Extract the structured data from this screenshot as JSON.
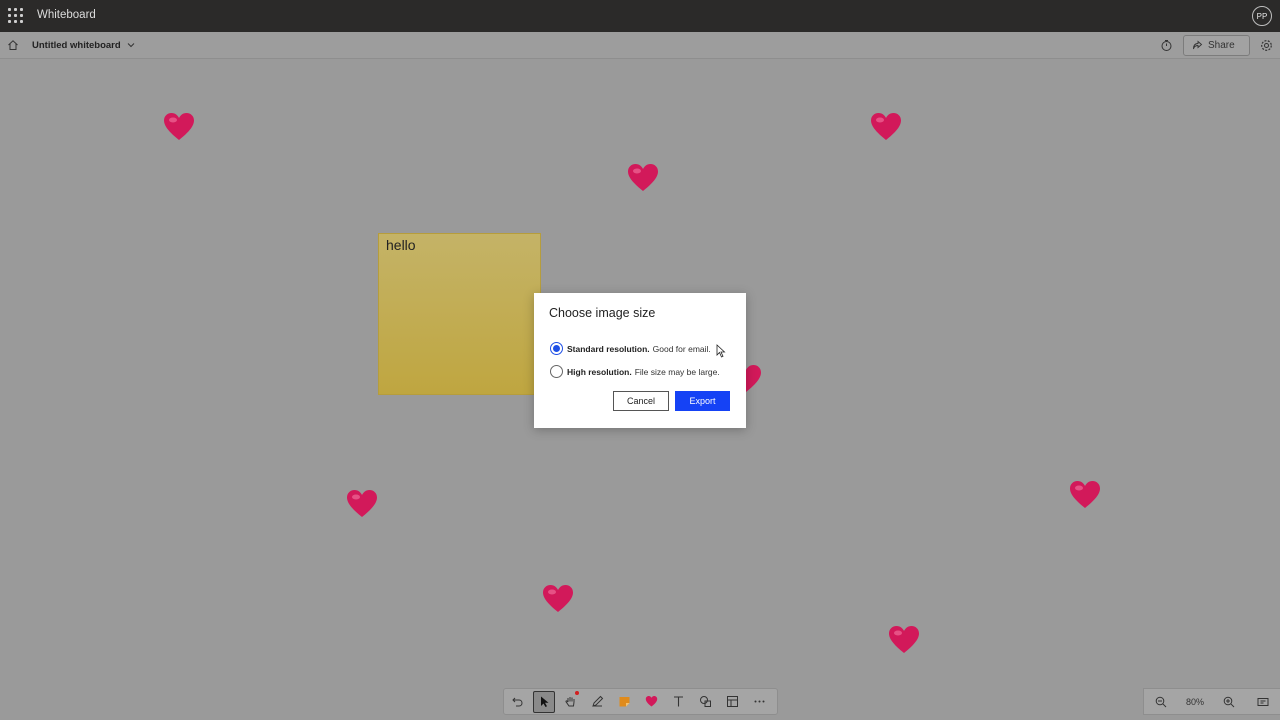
{
  "topbar": {
    "app_title": "Whiteboard",
    "avatar_initials": "PP"
  },
  "subbar": {
    "board_name": "Untitled whiteboard",
    "share_label": "Share"
  },
  "canvas": {
    "sticky_note_text": "hello",
    "sticky_color": "#c2ad55",
    "heart_color": "#d2195a"
  },
  "dialog": {
    "title": "Choose image size",
    "options": [
      {
        "bold": "Standard resolution.",
        "text": "Good for email.",
        "selected": true
      },
      {
        "bold": "High resolution.",
        "text": "File size may be large.",
        "selected": false
      }
    ],
    "cancel_label": "Cancel",
    "export_label": "Export",
    "accent_color": "#1542f5"
  },
  "toolbar": {
    "tools": [
      "undo-icon",
      "select-icon",
      "hand-icon",
      "pen-icon",
      "sticky-note-icon",
      "heart-reaction-icon",
      "text-icon",
      "shapes-icon",
      "templates-icon",
      "more-icon"
    ]
  },
  "zoom": {
    "level": "80%"
  }
}
